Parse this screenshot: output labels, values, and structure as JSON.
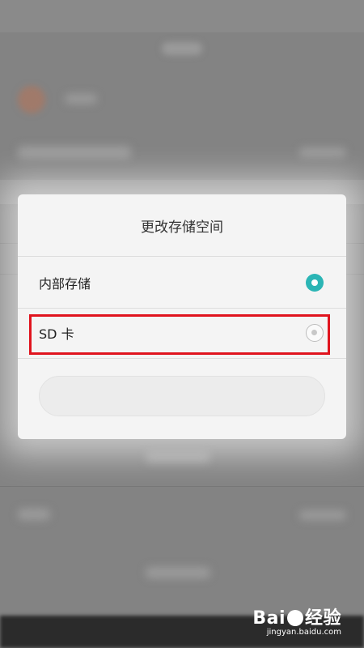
{
  "dialog": {
    "title": "更改存储空间",
    "options": [
      {
        "label": "内部存储",
        "selected": true
      },
      {
        "label": "SD 卡",
        "selected": false
      }
    ]
  },
  "colors": {
    "accent": "#2bb5b5",
    "highlight": "#e0141e"
  },
  "watermark": {
    "brand_left": "Bai",
    "brand_right": "经验",
    "url": "jingyan.baidu.com"
  }
}
